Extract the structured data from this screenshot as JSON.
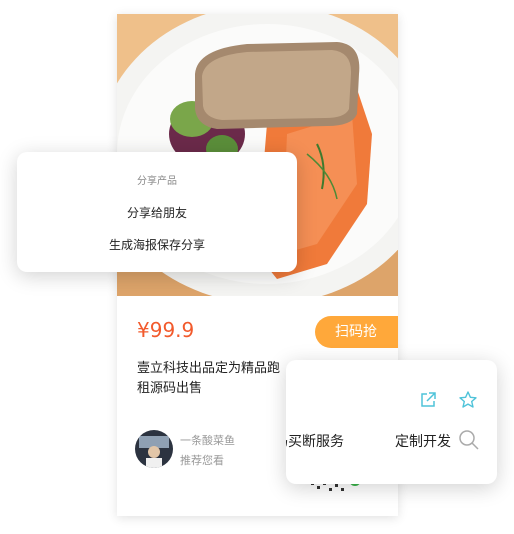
{
  "product": {
    "price": "¥99.9",
    "scan_button": "扫码抢",
    "title_line1": "壹立科技出品定为精品跑",
    "title_line2": "租源码出售",
    "author_name": "一条酸菜鱼",
    "author_sub": "推荐您看"
  },
  "share_menu": {
    "heading": "分享产品",
    "option_friends": "分享给朋友",
    "option_poster": "生成海报保存分享"
  },
  "service_menu": {
    "item1": "码买断服务",
    "item2": "定制开发",
    "icons": [
      "external-link-icon",
      "star-icon",
      "search-icon"
    ]
  },
  "colors": {
    "price": "#f25a2c",
    "scan_button": "#ffa83a",
    "icon_accent": "#4fc3d9"
  }
}
